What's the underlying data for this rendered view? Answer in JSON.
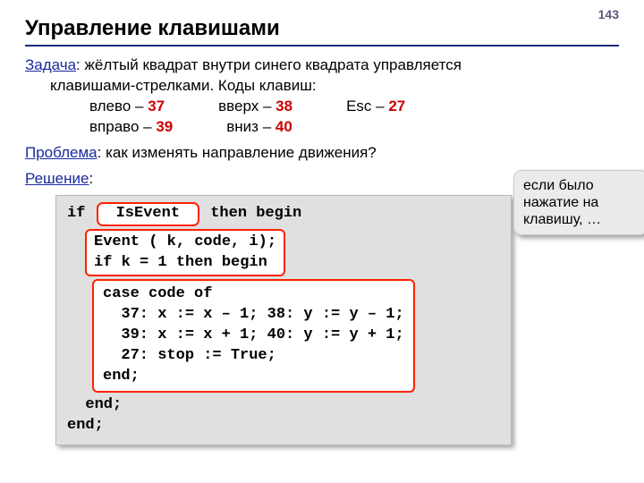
{
  "page_number": "143",
  "title": "Управление клавишами",
  "task": {
    "label": "Задача",
    "text_part1": ": жёлтый квадрат внутри синего квадрата управляется",
    "text_part2": "клавишами-стрелками. Коды клавиш:",
    "keys": {
      "left_label": "влево – ",
      "left_code": "37",
      "right_label": "вправо – ",
      "right_code": "39",
      "up_label": "вверх – ",
      "up_code": "38",
      "down_label": "вниз – ",
      "down_code": "40",
      "esc_label": "Esc – ",
      "esc_code": "27"
    }
  },
  "problem": {
    "label": "Проблема",
    "text": ": как изменять направление движения?"
  },
  "solution": {
    "label": "Решение",
    "text": ":"
  },
  "code": {
    "if_kw": "if ",
    "isevent": "IsEvent",
    "then_begin": " then begin",
    "event_line": "Event ( k, code, i);\nif k = 1 then begin",
    "case_block": "case code of\n  37: x := x – 1; 38: y := y – 1;\n  39: x := x + 1; 40: y := y + 1;\n  27: stop := True;\nend;",
    "end_inner": "  end;",
    "end_outer": "end;"
  },
  "callout": "если было нажатие на клавишу, …"
}
